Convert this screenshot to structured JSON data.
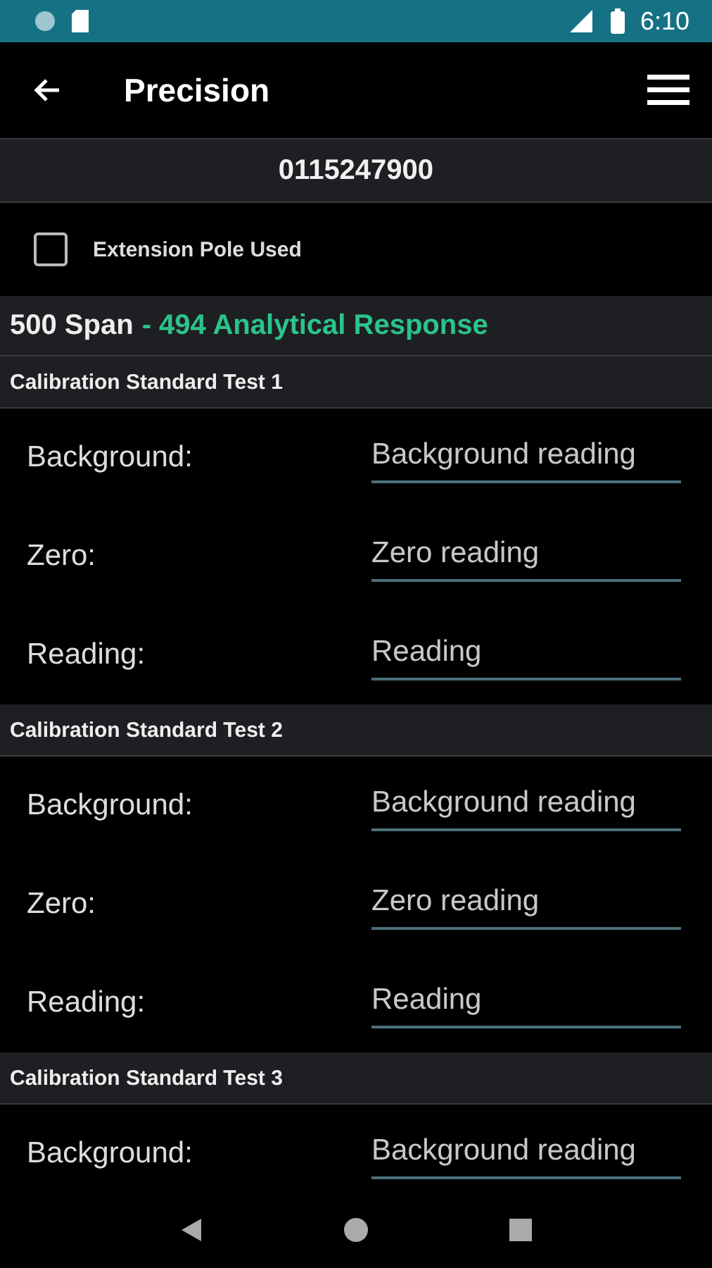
{
  "status_bar": {
    "time": "6:10"
  },
  "app_bar": {
    "title": "Precision"
  },
  "serial": "0115247900",
  "extension_pole": {
    "label": "Extension Pole Used",
    "checked": false
  },
  "span": {
    "value": "500 Span",
    "response": "- 494 Analytical Response"
  },
  "tests": [
    {
      "title": "Calibration Standard Test 1",
      "fields": [
        {
          "label": "Background:",
          "placeholder": "Background reading"
        },
        {
          "label": "Zero:",
          "placeholder": "Zero reading"
        },
        {
          "label": "Reading:",
          "placeholder": "Reading"
        }
      ]
    },
    {
      "title": "Calibration Standard Test 2",
      "fields": [
        {
          "label": "Background:",
          "placeholder": "Background reading"
        },
        {
          "label": "Zero:",
          "placeholder": "Zero reading"
        },
        {
          "label": "Reading:",
          "placeholder": "Reading"
        }
      ]
    },
    {
      "title": "Calibration Standard Test 3",
      "fields": [
        {
          "label": "Background:",
          "placeholder": "Background reading"
        }
      ]
    }
  ]
}
